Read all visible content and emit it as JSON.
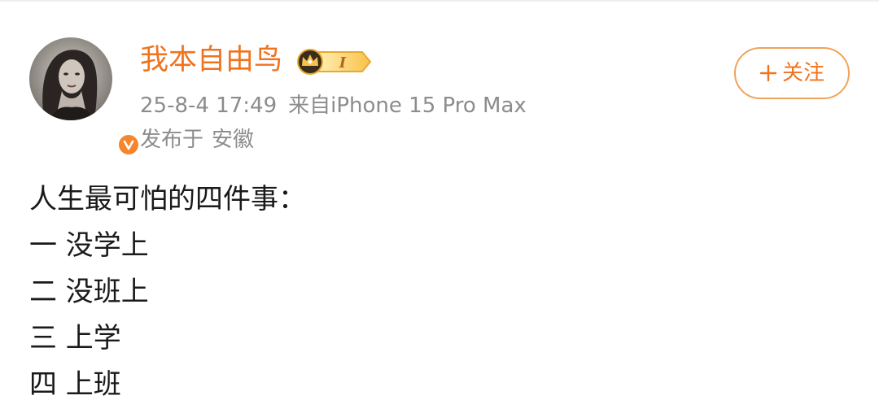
{
  "post": {
    "author": {
      "name": "我本自由鸟",
      "vip_level": "I",
      "verified": true
    },
    "meta": {
      "time": "25-8-4 17:49",
      "source": "来自iPhone 15 Pro Max",
      "location_prefix": "发布于",
      "location": "安徽"
    },
    "follow_label": "关注",
    "content": [
      "人生最可怕的四件事：",
      "一 没学上",
      "二 没班上",
      "三 上学",
      "四 上班"
    ]
  },
  "colors": {
    "accent": "#f0731e",
    "meta_text": "#8c8c8c",
    "body_text": "#1a1a1a",
    "verified_badge": "#f7852c",
    "follow_border": "#f0a35a"
  },
  "icons": {
    "avatar": "avatar-photo",
    "verified": "verified-v-icon",
    "vip": "crown-vip-icon",
    "follow": "plus-icon"
  }
}
